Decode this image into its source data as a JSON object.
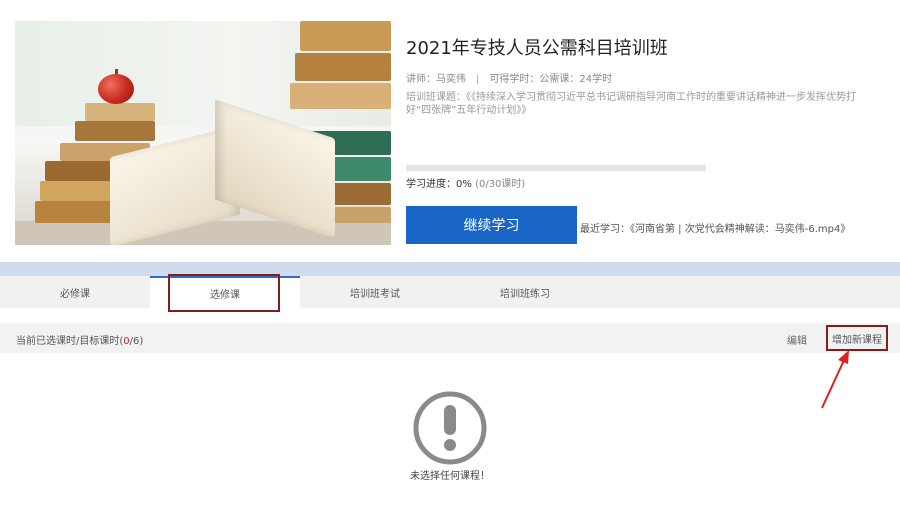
{
  "course": {
    "title": "2021年专技人员公需科目培训班",
    "teacher": "讲师：马奕伟",
    "credits": "可得学时：公需课：24学时",
    "description": "培训班课题：《《持续深入学习贯彻习近平总书记调研指导河南工作时的重要讲话精神进一步发挥优势打好“四张牌”五年行动计划》》",
    "progress_label": "学习进度：0%",
    "progress_detail": "(0/30课时)",
    "progress_fraction": 0,
    "continue_label": "继续学习",
    "recent_study": "最近学习：《河南省第 | 次党代会精神解读：马奕伟-6.mp4》"
  },
  "tabs": [
    {
      "label": "必修课"
    },
    {
      "label": "选修课"
    },
    {
      "label": "培训班考试"
    },
    {
      "label": "培训班练习"
    }
  ],
  "active_tab": 1,
  "toolbar": {
    "hours_prefix": "当前已选课时/目标课时(",
    "hours_selected": "0",
    "hours_suffix": "/6)",
    "edit_label": "编辑",
    "add_label": "增加新课程"
  },
  "empty_state": {
    "message": "未选择任何课程！",
    "icon": "exclamation-circle-icon"
  },
  "colors": {
    "primary": "#1a66c7",
    "highlight_box": "#7d1f1f",
    "arrow": "#e02020",
    "count_red": "#d42020"
  }
}
